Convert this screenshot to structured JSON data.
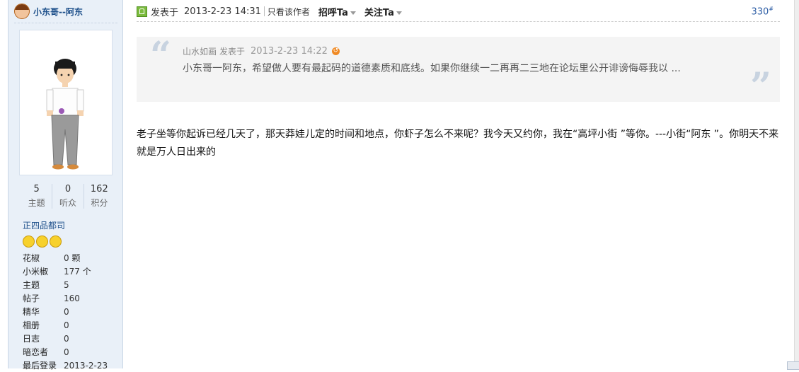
{
  "author": {
    "name": "小东哥--阿东"
  },
  "stats": [
    {
      "value": "5",
      "label": "主题"
    },
    {
      "value": "0",
      "label": "听众"
    },
    {
      "value": "162",
      "label": "积分"
    }
  ],
  "rank": "正四品都司",
  "medal_icons": [
    "smiley-medal-icon",
    "moon-medal-icon",
    "moon-medal-icon"
  ],
  "info": [
    {
      "k": "花椒",
      "v": "0 颗"
    },
    {
      "k": "小米椒",
      "v": "177 个"
    },
    {
      "k": "主题",
      "v": "5"
    },
    {
      "k": "帖子",
      "v": "160"
    },
    {
      "k": "精华",
      "v": "0"
    },
    {
      "k": "相册",
      "v": "0"
    },
    {
      "k": "日志",
      "v": "0"
    },
    {
      "k": "暗恋者",
      "v": "0"
    },
    {
      "k": "最后登录",
      "v": "2013-2-23"
    }
  ],
  "meta": {
    "posted_label": "发表于",
    "posted_time": "2013-2-23 14:31",
    "view_only": "只看该作者",
    "greet": "招呼Ta",
    "follow": "关注Ta",
    "floor": "330",
    "floor_sup": "#"
  },
  "quote": {
    "author": "山水如画",
    "posted_label": "发表于",
    "time": "2013-2-23 14:22",
    "body": "小东哥一阿东，希望做人要有最起码的道德素质和底线。如果你继续一二再再二三地在论坛里公开诽谤侮辱我以 ..."
  },
  "content": "老子坐等你起诉已经几天了，那天莽娃儿定的时间和地点，你虾子怎么不来呢？我今天又约你，我在“高坪小街 ”等你。---小街“阿东 ”。你明天不来就是万人日出来的",
  "colors": {
    "sidebar_bg": "#e9f0f8",
    "link": "#1d4f8a",
    "floor": "#2f5fa6",
    "quote_bg": "#f4f4f4"
  }
}
